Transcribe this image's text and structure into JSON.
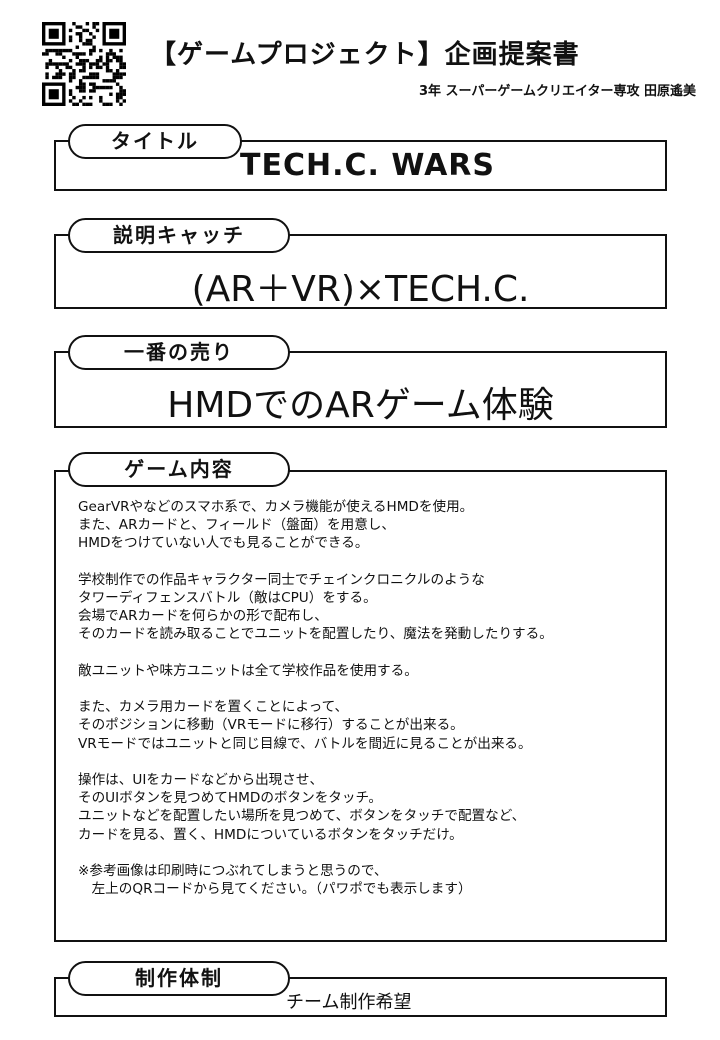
{
  "header": {
    "qr_icon": "qr-code-icon",
    "title": "【ゲームプロジェクト】企画提案書",
    "author": "3年 スーパーゲームクリエイター専攻 田原遙美"
  },
  "sections": {
    "title": {
      "label": "タイトル",
      "value": "TECH.C. WARS"
    },
    "catch": {
      "label": "説明キャッチ",
      "value": "(AR＋VR)×TECH.C."
    },
    "selling": {
      "label": "一番の売り",
      "value": "HMDでのARゲーム体験"
    },
    "content": {
      "label": "ゲーム内容",
      "lines": [
        "GearVRやなどのスマホ系で、カメラ機能が使えるHMDを使用。",
        "また、ARカードと、フィールド（盤面）を用意し、",
        "HMDをつけていない人でも見ることができる。",
        "",
        "学校制作での作品キャラクター同士でチェインクロニクルのような",
        "タワーディフェンスバトル（敵はCPU）をする。",
        "会場でARカードを何らかの形で配布し、",
        "そのカードを読み取ることでユニットを配置したり、魔法を発動したりする。",
        "",
        "敵ユニットや味方ユニットは全て学校作品を使用する。",
        "",
        "また、カメラ用カードを置くことによって、",
        "そのポジションに移動（VRモードに移行）することが出来る。",
        "VRモードではユニットと同じ目線で、バトルを間近に見ることが出来る。",
        "",
        "操作は、UIをカードなどから出現させ、",
        "そのUIボタンを見つめてHMDのボタンをタッチ。",
        "ユニットなどを配置したい場所を見つめて、ボタンをタッチで配置など、",
        "カードを見る、置く、HMDについているボタンをタッチだけ。",
        "",
        "※参考画像は印刷時につぶれてしまうと思うので、",
        "　左上のQRコードから見てください。（パワポでも表示します）"
      ]
    },
    "team": {
      "label": "制作体制",
      "value": "チーム制作希望"
    }
  }
}
